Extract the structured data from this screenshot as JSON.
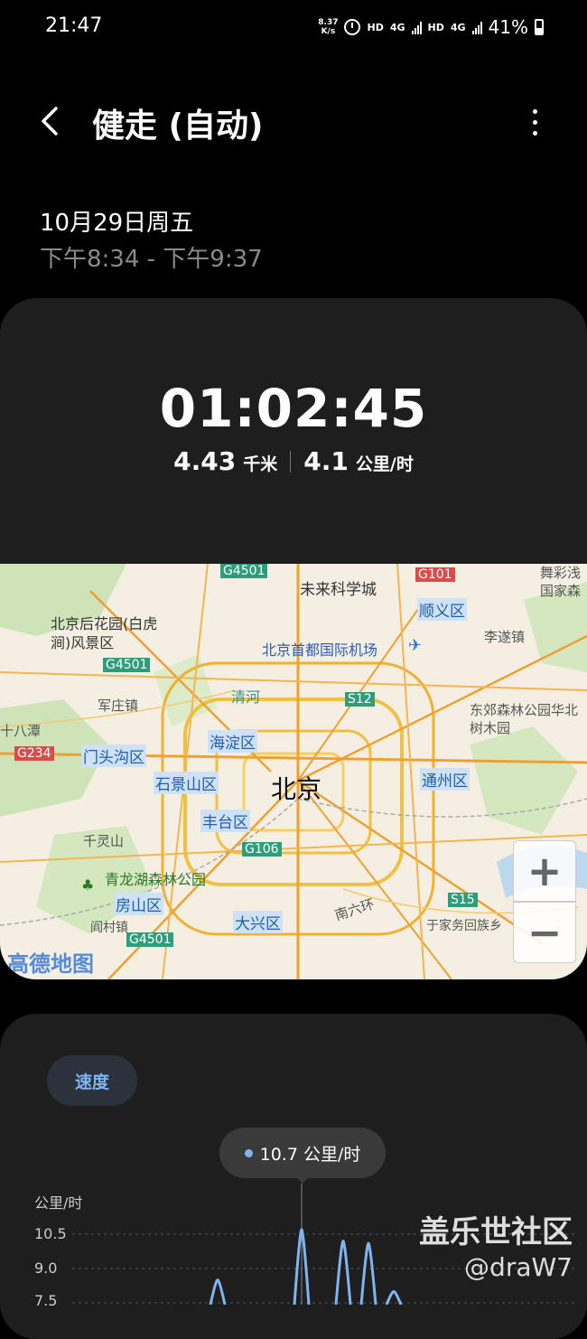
{
  "status_bar": {
    "time": "21:47",
    "net_speed_value": "8.37",
    "net_speed_unit": "K/s",
    "hd1": "HD",
    "net1": "4G",
    "hd2": "HD",
    "net2": "4G",
    "battery": "41%"
  },
  "header": {
    "title": "健走 (自动)"
  },
  "session": {
    "date": "10月29日周五",
    "time_range": "下午8:34 - 下午9:37"
  },
  "summary": {
    "duration": "01:02:45",
    "distance_value": "4.43",
    "distance_unit": "千米",
    "speed_value": "4.1",
    "speed_unit": "公里/时"
  },
  "map": {
    "labels": {
      "beijing": "北京",
      "haidian": "海淀区",
      "shijingshan": "石景山区",
      "fengtai": "丰台区",
      "mentougou": "门头沟区",
      "tongzhou": "通州区",
      "daxing": "大兴区",
      "fangshan": "房山区",
      "shunyi": "顺义区",
      "airport": "北京首都国际机场",
      "future_city": "未来科学城",
      "houhuayuan": "北京后花园(白虎涧)风景区",
      "qinglonghu": "青龙湖森林公园",
      "jundu": "军庄镇",
      "lingshan": "千灵山",
      "shibatan": "十八潭",
      "qinghe": "清河",
      "lisui": "李遂镇",
      "dongjiao": "东郊森林公园华北树木园",
      "nanliuhuan": "南六环",
      "yancun": "阎村镇",
      "yujiawu": "于家务回族乡",
      "wucai": "舞彩浅国家森",
      "g4501_top": "G4501",
      "g4501_left": "G4501",
      "g4501_bottom": "G4501",
      "g101": "G101",
      "s12": "S12",
      "g234": "G234",
      "g106": "G106",
      "s15": "S15",
      "logo": "高德地图"
    },
    "zoom_in": "+",
    "zoom_out": "−"
  },
  "chart": {
    "tab_label": "速度",
    "tooltip": "10.7 公里/时",
    "y_unit": "公里/时",
    "chart_data": {
      "type": "line",
      "title": "",
      "ylabel": "公里/时",
      "yticks": [
        "10.5",
        "9.0",
        "7.5"
      ],
      "highlight_value": 10.7,
      "series": [
        {
          "values": [
            0,
            0,
            8.5,
            0,
            0,
            0,
            10.7,
            0,
            10.2,
            0,
            10.1,
            0,
            8.0,
            0
          ]
        }
      ]
    }
  },
  "watermark": {
    "line1": "盖乐世社区",
    "line2": "@draW7"
  }
}
